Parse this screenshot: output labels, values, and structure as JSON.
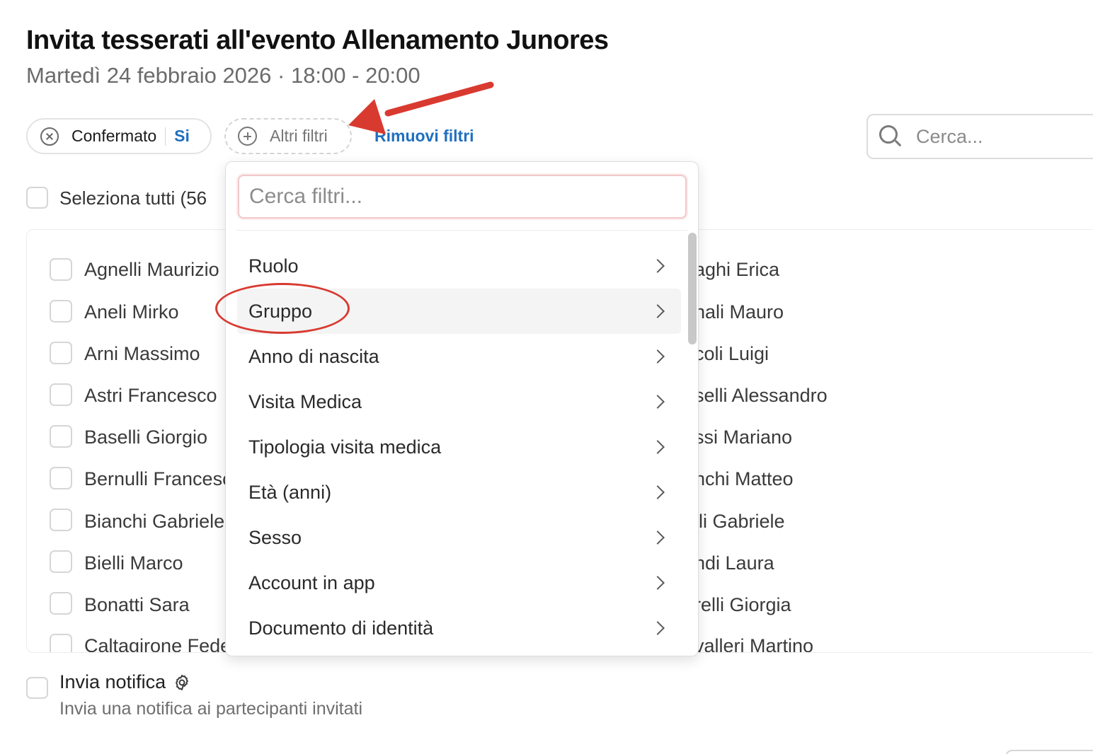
{
  "header": {
    "title": "Invita tesserati all'evento Allenamento Junores",
    "subtitle": "Martedì 24 febbraio 2026 · 18:00 - 20:00"
  },
  "filters": {
    "active": {
      "label": "Confermato",
      "value": "Si"
    },
    "more_label": "Altri filtri",
    "remove_label": "Rimuovi filtri"
  },
  "search": {
    "placeholder": "Cerca..."
  },
  "select_all": {
    "label": "Seleziona tutti (56"
  },
  "members_left": [
    "Agnelli Maurizio",
    "Aneli Mirko",
    "Arni Massimo",
    "Astri Francesco",
    "Baselli Giorgio",
    "Bernulli Francesco",
    "Bianchi Gabriele",
    "Bielli Marco",
    "Bonatti Sara",
    "Caltagirone Federico"
  ],
  "members_right": [
    "aghi Erica",
    "nali Mauro",
    "coli Luigi",
    "selli Alessandro",
    "ssi Mariano",
    "nchi Matteo",
    "lli Gabriele",
    "ndi Laura",
    "relli Giorgia",
    "valleri Martino"
  ],
  "dropdown": {
    "search_placeholder": "Cerca filtri...",
    "items": [
      {
        "label": "Ruolo"
      },
      {
        "label": "Gruppo"
      },
      {
        "label": "Anno di nascita"
      },
      {
        "label": "Visita Medica"
      },
      {
        "label": "Tipologia visita medica"
      },
      {
        "label": "Età (anni)"
      },
      {
        "label": "Sesso"
      },
      {
        "label": "Account in app"
      },
      {
        "label": "Documento di identità"
      }
    ],
    "highlighted": "Gruppo"
  },
  "notification": {
    "label": "Invia notifica",
    "description": "Invia una notifica ai partecipanti invitati"
  },
  "colors": {
    "accent_link": "#1f6fbf",
    "annotation_red": "#d93a30"
  },
  "icons": [
    "close-circle-icon",
    "plus-circle-icon",
    "search-icon",
    "chevron-right-icon",
    "gear-icon"
  ]
}
